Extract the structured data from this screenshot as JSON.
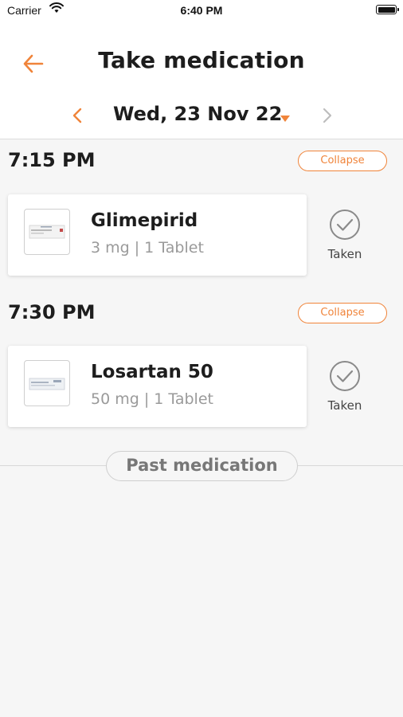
{
  "status_bar": {
    "carrier": "Carrier",
    "time": "6:40 PM"
  },
  "header": {
    "title": "Take medication",
    "date": "Wed, 23 Nov 22"
  },
  "colors": {
    "accent": "#f0843a",
    "muted": "#9a9a9a"
  },
  "schedule": [
    {
      "time": "7:15 PM",
      "collapse_label": "Collapse",
      "med_name": "Glimepirid",
      "med_dose": "3 mg | 1 Tablet",
      "taken_label": "Taken"
    },
    {
      "time": "7:30 PM",
      "collapse_label": "Collapse",
      "med_name": "Losartan 50",
      "med_dose": "50 mg | 1 Tablet",
      "taken_label": "Taken"
    }
  ],
  "past_medication_label": "Past medication",
  "icons": {
    "back": "back-arrow-icon",
    "prev": "chevron-left-icon",
    "next": "chevron-right-icon",
    "caret": "caret-down-icon",
    "taken": "check-circle-icon"
  }
}
